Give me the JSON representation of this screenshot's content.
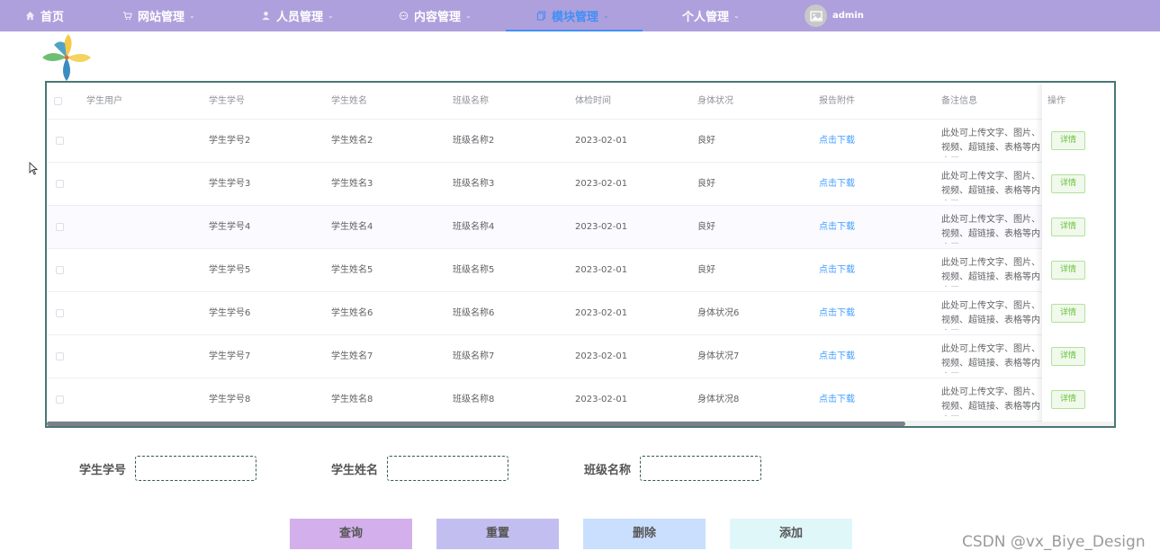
{
  "nav": {
    "items": [
      {
        "label": "首页",
        "icon": "home-icon",
        "has_caret": false
      },
      {
        "label": "网站管理",
        "icon": "cart-icon",
        "has_caret": true
      },
      {
        "label": "人员管理",
        "icon": "user-icon",
        "has_caret": true
      },
      {
        "label": "内容管理",
        "icon": "chat-icon",
        "has_caret": true
      },
      {
        "label": "模块管理",
        "icon": "copy-icon",
        "has_caret": true,
        "active": true
      },
      {
        "label": "个人管理",
        "icon": "",
        "has_caret": true
      }
    ],
    "caret": "⌄",
    "user_name": "admin"
  },
  "table": {
    "headers": {
      "user": "学生用户",
      "id": "学生学号",
      "name": "学生姓名",
      "class": "班级名称",
      "time": "体检时间",
      "health": "身体状况",
      "report": "报告附件",
      "note": "备注信息",
      "op": "操作"
    },
    "rows": [
      {
        "user": "",
        "id": "学生学号2",
        "name": "学生姓名2",
        "class": "班级名称2",
        "time": "2023-02-01",
        "health": "良好",
        "report": "点击下载",
        "note": "此处可上传文字、图片、视频、超链接、表格等内容区",
        "op": "详情"
      },
      {
        "user": "",
        "id": "学生学号3",
        "name": "学生姓名3",
        "class": "班级名称3",
        "time": "2023-02-01",
        "health": "良好",
        "report": "点击下载",
        "note": "此处可上传文字、图片、视频、超链接、表格等内容区",
        "op": "详情"
      },
      {
        "user": "",
        "id": "学生学号4",
        "name": "学生姓名4",
        "class": "班级名称4",
        "time": "2023-02-01",
        "health": "良好",
        "report": "点击下载",
        "note": "此处可上传文字、图片、视频、超链接、表格等内容区",
        "op": "详情"
      },
      {
        "user": "",
        "id": "学生学号5",
        "name": "学生姓名5",
        "class": "班级名称5",
        "time": "2023-02-01",
        "health": "良好",
        "report": "点击下载",
        "note": "此处可上传文字、图片、视频、超链接、表格等内容区",
        "op": "详情"
      },
      {
        "user": "",
        "id": "学生学号6",
        "name": "学生姓名6",
        "class": "班级名称6",
        "time": "2023-02-01",
        "health": "身体状况6",
        "report": "点击下载",
        "note": "此处可上传文字、图片、视频、超链接、表格等内容区",
        "op": "详情"
      },
      {
        "user": "",
        "id": "学生学号7",
        "name": "学生姓名7",
        "class": "班级名称7",
        "time": "2023-02-01",
        "health": "身体状况7",
        "report": "点击下载",
        "note": "此处可上传文字、图片、视频、超链接、表格等内容区",
        "op": "详情"
      },
      {
        "user": "",
        "id": "学生学号8",
        "name": "学生姓名8",
        "class": "班级名称8",
        "time": "2023-02-01",
        "health": "身体状况8",
        "report": "点击下载",
        "note": "此处可上传文字、图片、视频、超链接、表格等内容区",
        "op": "详情"
      }
    ]
  },
  "search": {
    "id_label": "学生学号",
    "id_value": "",
    "name_label": "学生姓名",
    "name_value": "",
    "class_label": "班级名称",
    "class_value": ""
  },
  "actions": {
    "query": "查询",
    "reset": "重置",
    "delete": "删除",
    "add": "添加"
  },
  "colors": {
    "nav_bg": "#aea0dc",
    "nav_active": "#3f8ff7",
    "query_btn": "#d3b0ec",
    "reset_btn": "#c3bef0",
    "delete_btn": "#cadffe",
    "add_btn": "#e0f7fa",
    "link": "#409eff",
    "detail_btn": "#67c23a"
  },
  "watermark": "CSDN @vx_Biye_Design"
}
